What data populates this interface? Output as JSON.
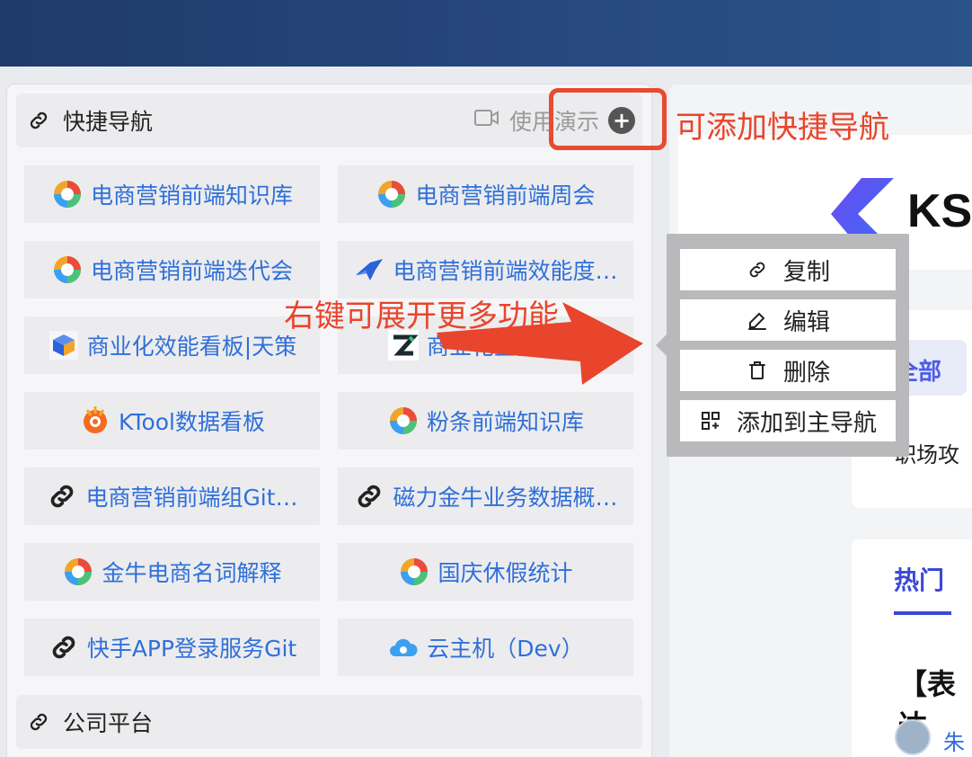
{
  "shortcuts_section": {
    "title": "快捷导航",
    "demo_label": "使用演示",
    "add_symbol": "+"
  },
  "shortcuts": [
    {
      "label": "电商营销前端知识库",
      "icon": "docs-logo-icon"
    },
    {
      "label": "电商营销前端周会",
      "icon": "docs-logo-icon"
    },
    {
      "label": "电商营销前端迭代会",
      "icon": "docs-logo-icon"
    },
    {
      "label": "电商营销前端效能度…",
      "icon": "bird-logo-icon"
    },
    {
      "label": "商业化效能看板|天策",
      "icon": "cube-chart-icon"
    },
    {
      "label": "商业化监控报警",
      "icon": "z-logo-icon"
    },
    {
      "label": "KTool数据看板",
      "icon": "grafana-icon"
    },
    {
      "label": "粉条前端知识库",
      "icon": "docs-logo-icon"
    },
    {
      "label": "电商营销前端组Git…",
      "icon": "link-icon"
    },
    {
      "label": "磁力金牛业务数据概…",
      "icon": "link-icon"
    },
    {
      "label": "金牛电商名词解释",
      "icon": "docs-logo-icon"
    },
    {
      "label": "国庆休假统计",
      "icon": "docs-logo-icon"
    },
    {
      "label": "快手APP登录服务Git",
      "icon": "link-icon"
    },
    {
      "label": "云主机（Dev）",
      "icon": "cloud-icon"
    }
  ],
  "company_section": {
    "title": "公司平台"
  },
  "context_menu": {
    "items": [
      {
        "label": "复制",
        "icon": "link-icon"
      },
      {
        "label": "编辑",
        "icon": "pencil-icon"
      },
      {
        "label": "删除",
        "icon": "trash-icon"
      },
      {
        "label": "添加到主导航",
        "icon": "grid-add-icon"
      }
    ]
  },
  "annotations": {
    "add_shortcut": "可添加快捷导航",
    "right_click": "右键可展开更多功能"
  },
  "right_panel": {
    "brand": "KS",
    "filter_all": "全部",
    "career": "职场攻",
    "tab_hot": "热门",
    "article_title": "【表达",
    "author": "朱"
  },
  "colors": {
    "accent_blue": "#2f6fd9",
    "annotation_red": "#e8452c",
    "header_navy": "#1f3a6b"
  }
}
